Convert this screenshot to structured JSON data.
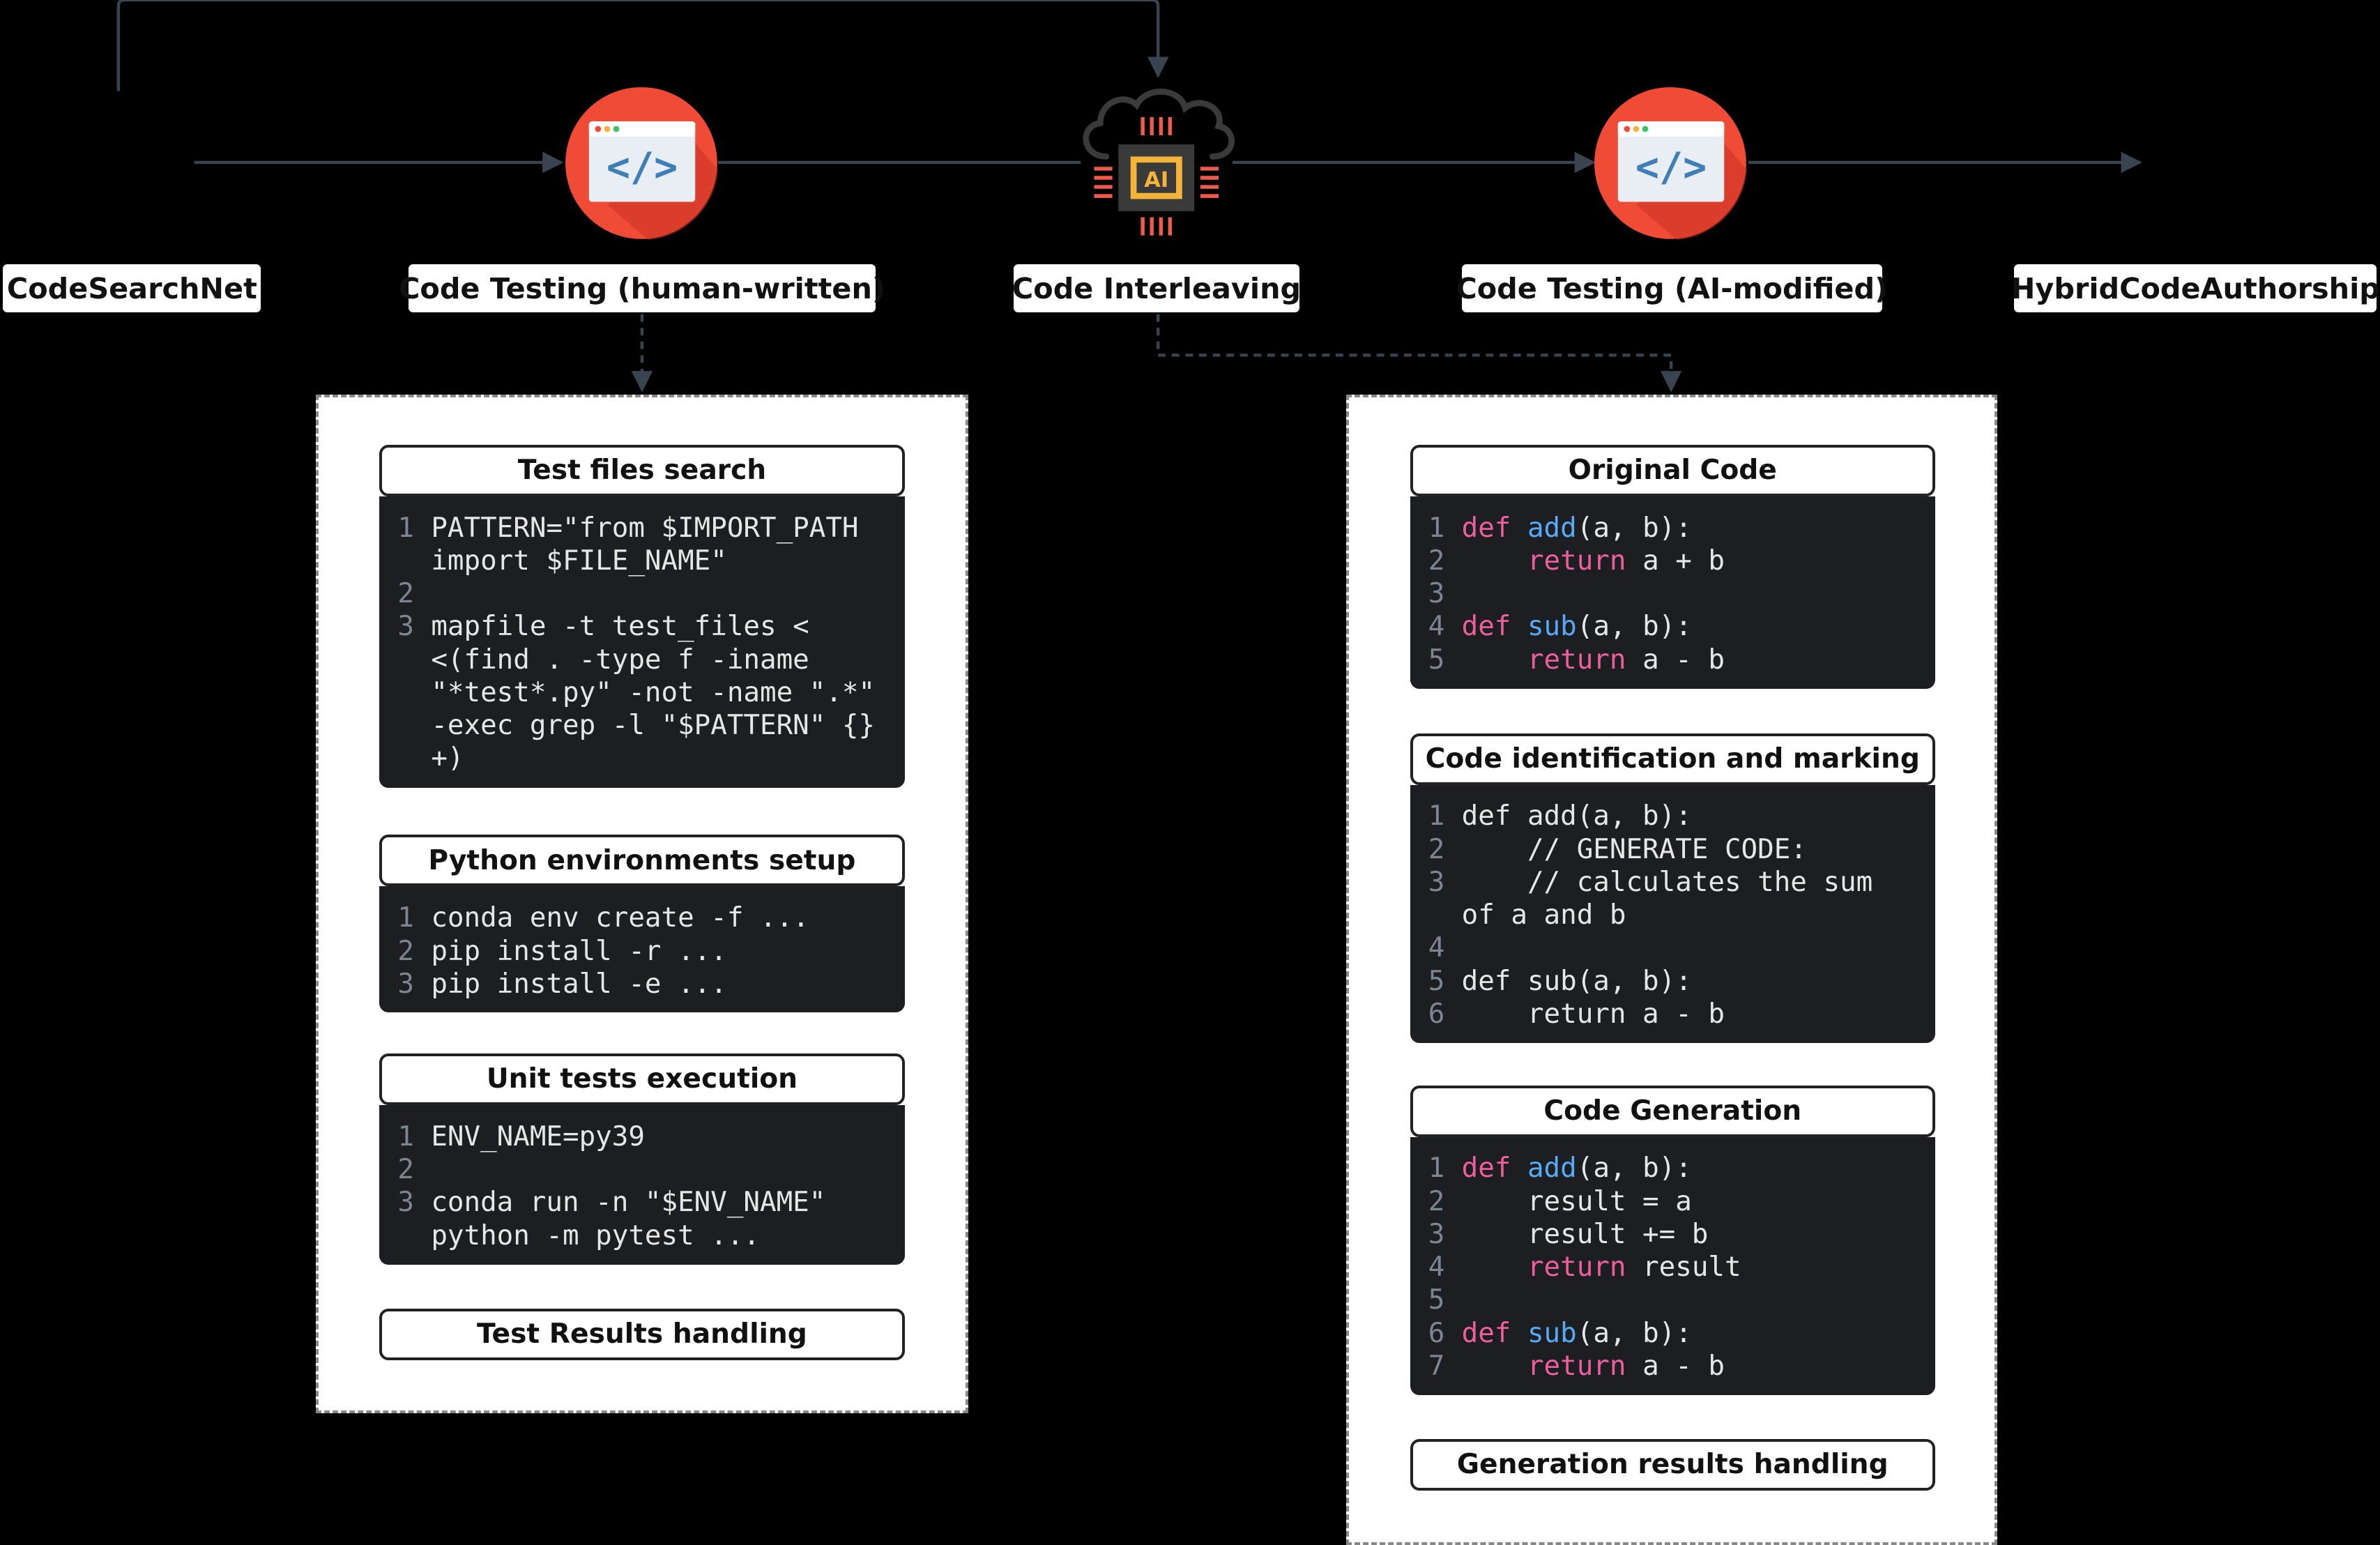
{
  "pipeline": {
    "codesearchnet": "CodeSearchNet",
    "testing_human": "Code Testing (human-written)",
    "interleaving": "Code Interleaving",
    "testing_ai": "Code Testing (AI-modified)",
    "hybrid": "HybridCodeAuthorship"
  },
  "icons": {
    "code_window": "code-window-icon",
    "ai_cloud_chip": "ai-chip-cloud-icon",
    "chip_text": "AI"
  },
  "colors": {
    "icon_red": "#f04b37",
    "chip_gold": "#f4b43a",
    "keyword": "#ec5f9c",
    "function": "#58aaf5"
  },
  "left_panel": {
    "test_search_title": "Test files search",
    "test_search_code": [
      {
        "n": "1",
        "t": "PATTERN=\"from $IMPORT_PATH import $FILE_NAME\""
      },
      {
        "n": "2",
        "t": ""
      },
      {
        "n": "3",
        "t": "mapfile -t test_files < <(find . -type f -iname \"*test*.py\" -not -name \".*\" -exec grep -l \"$PATTERN\" {} +)"
      }
    ],
    "env_setup_title": "Python environments setup",
    "env_setup_code": [
      {
        "n": "1",
        "t": "conda env create -f ..."
      },
      {
        "n": "2",
        "t": "pip install -r ..."
      },
      {
        "n": "3",
        "t": "pip install -e ..."
      }
    ],
    "unit_tests_title": "Unit tests execution",
    "unit_tests_code": [
      {
        "n": "1",
        "t": "ENV_NAME=py39"
      },
      {
        "n": "2",
        "t": ""
      },
      {
        "n": "3",
        "t": "conda run -n \"$ENV_NAME\" python -m pytest ..."
      }
    ],
    "results_title": "Test Results handling"
  },
  "right_panel": {
    "original_title": "Original Code",
    "original_code": [
      {
        "n": "1",
        "parts": [
          [
            "kw",
            "def "
          ],
          [
            "fn",
            "add"
          ],
          [
            "",
            "(a, b):"
          ]
        ]
      },
      {
        "n": "2",
        "parts": [
          [
            "",
            "    "
          ],
          [
            "kw",
            "return"
          ],
          [
            "",
            " a + b"
          ]
        ]
      },
      {
        "n": "3",
        "parts": []
      },
      {
        "n": "4",
        "parts": [
          [
            "kw",
            "def "
          ],
          [
            "fn",
            "sub"
          ],
          [
            "",
            "(a, b):"
          ]
        ]
      },
      {
        "n": "5",
        "parts": [
          [
            "",
            "    "
          ],
          [
            "kw",
            "return"
          ],
          [
            "",
            " a - b"
          ]
        ]
      }
    ],
    "marking_title": "Code identification and marking",
    "marking_code": [
      {
        "n": "1",
        "parts": [
          [
            "",
            "def add(a, b):"
          ]
        ]
      },
      {
        "n": "2",
        "parts": [
          [
            "",
            "    // GENERATE CODE:"
          ]
        ]
      },
      {
        "n": "3",
        "parts": [
          [
            "",
            "    // calculates the sum of a and b"
          ]
        ]
      },
      {
        "n": "4",
        "parts": []
      },
      {
        "n": "5",
        "parts": [
          [
            "",
            "def sub(a, b):"
          ]
        ]
      },
      {
        "n": "6",
        "parts": [
          [
            "",
            "    return a - b"
          ]
        ]
      }
    ],
    "generation_title": "Code Generation",
    "generation_code": [
      {
        "n": "1",
        "parts": [
          [
            "kw",
            "def "
          ],
          [
            "fn",
            "add"
          ],
          [
            "",
            "(a, b):"
          ]
        ]
      },
      {
        "n": "2",
        "parts": [
          [
            "",
            "    result = a"
          ]
        ]
      },
      {
        "n": "3",
        "parts": [
          [
            "",
            "    result += b"
          ]
        ]
      },
      {
        "n": "4",
        "parts": [
          [
            "",
            "    "
          ],
          [
            "kw",
            "return"
          ],
          [
            "",
            " result"
          ]
        ]
      },
      {
        "n": "5",
        "parts": []
      },
      {
        "n": "6",
        "parts": [
          [
            "kw",
            "def "
          ],
          [
            "fn",
            "sub"
          ],
          [
            "",
            "(a, b):"
          ]
        ]
      },
      {
        "n": "7",
        "parts": [
          [
            "",
            "    "
          ],
          [
            "kw",
            "return"
          ],
          [
            "",
            " a - b"
          ]
        ]
      }
    ],
    "gen_results_title": "Generation results handling"
  }
}
